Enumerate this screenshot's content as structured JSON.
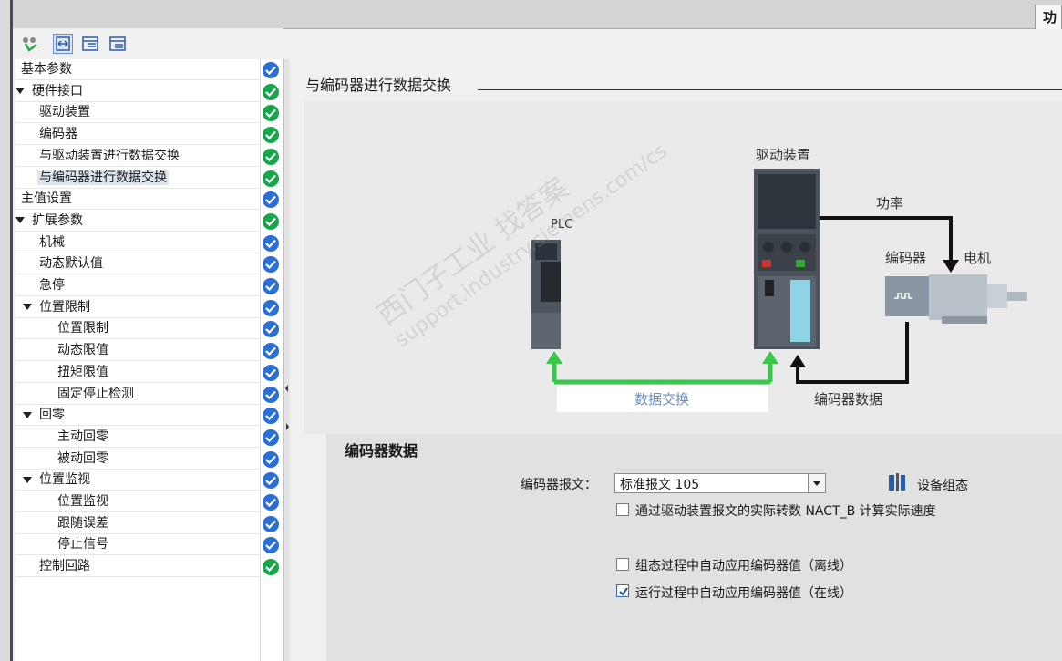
{
  "top_tab": {
    "label": "功"
  },
  "tree": {
    "items": [
      {
        "label": "基本参数",
        "indent": 0,
        "expander": false,
        "status": "blue"
      },
      {
        "label": "硬件接口",
        "indent": 0,
        "expander": true,
        "status": "green"
      },
      {
        "label": "驱动装置",
        "indent": 1,
        "expander": false,
        "status": "green"
      },
      {
        "label": "编码器",
        "indent": 1,
        "expander": false,
        "status": "green"
      },
      {
        "label": "与驱动装置进行数据交换",
        "indent": 1,
        "expander": false,
        "status": "green"
      },
      {
        "label": "与编码器进行数据交换",
        "indent": 1,
        "expander": false,
        "status": "green",
        "selected": true
      },
      {
        "label": "主值设置",
        "indent": 0,
        "expander": false,
        "status": "blue"
      },
      {
        "label": "扩展参数",
        "indent": 0,
        "expander": true,
        "status": "green"
      },
      {
        "label": "机械",
        "indent": 1,
        "expander": false,
        "status": "blue"
      },
      {
        "label": "动态默认值",
        "indent": 1,
        "expander": false,
        "status": "blue"
      },
      {
        "label": "急停",
        "indent": 1,
        "expander": false,
        "status": "blue"
      },
      {
        "label": "位置限制",
        "indent": 1,
        "expander": true,
        "status": "blue"
      },
      {
        "label": "位置限制",
        "indent": 2,
        "expander": false,
        "status": "blue"
      },
      {
        "label": "动态限值",
        "indent": 2,
        "expander": false,
        "status": "blue"
      },
      {
        "label": "扭矩限值",
        "indent": 2,
        "expander": false,
        "status": "blue"
      },
      {
        "label": "固定停止检测",
        "indent": 2,
        "expander": false,
        "status": "blue"
      },
      {
        "label": "回零",
        "indent": 1,
        "expander": true,
        "status": "blue"
      },
      {
        "label": "主动回零",
        "indent": 2,
        "expander": false,
        "status": "blue"
      },
      {
        "label": "被动回零",
        "indent": 2,
        "expander": false,
        "status": "blue"
      },
      {
        "label": "位置监视",
        "indent": 1,
        "expander": true,
        "status": "blue"
      },
      {
        "label": "位置监视",
        "indent": 2,
        "expander": false,
        "status": "blue"
      },
      {
        "label": "跟随误差",
        "indent": 2,
        "expander": false,
        "status": "blue"
      },
      {
        "label": "停止信号",
        "indent": 2,
        "expander": false,
        "status": "blue"
      },
      {
        "label": "控制回路",
        "indent": 1,
        "expander": false,
        "status": "green"
      }
    ]
  },
  "section": {
    "title": "与编码器进行数据交换"
  },
  "diagram": {
    "plc_label": "PLC",
    "drive_label": "驱动装置",
    "power_label": "功率",
    "encoder_label": "编码器",
    "motor_label": "电机",
    "data_exchange_label": "数据交换",
    "encoder_data_label": "编码器数据",
    "watermark_1": "西门子工业 找答案",
    "watermark_2": "support.industry.siemens.com/cs"
  },
  "form": {
    "heading": "编码器数据",
    "telegram_label": "编码器报文：",
    "telegram_value": "标准报文 105",
    "device_config_label": "设备组态",
    "opt_nact_label": "通过驱动装置报文的实际转数 NACT_B 计算实际速度",
    "opt_nact_checked": false,
    "opt_offline_label": "组态过程中自动应用编码器值（离线）",
    "opt_offline_checked": false,
    "opt_online_label": "运行过程中自动应用编码器值（在线）",
    "opt_online_checked": true
  },
  "colors": {
    "accent": "#2a6fd6",
    "ok_green": "#19a64a",
    "arrow_green": "#39c84a"
  }
}
